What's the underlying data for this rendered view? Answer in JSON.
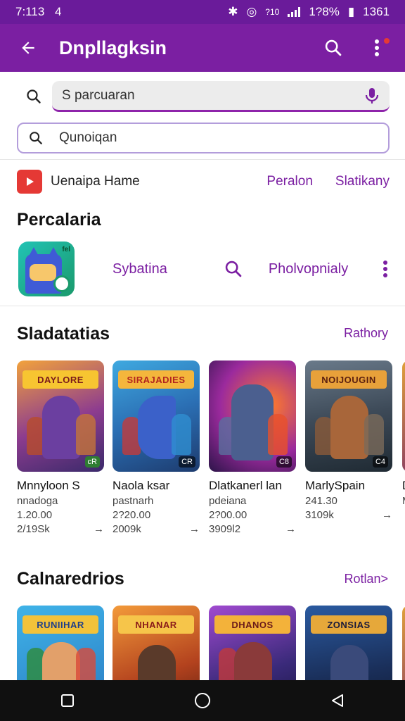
{
  "status": {
    "time": "7:113",
    "extra": "4",
    "battery": "1?8%",
    "clock2": "1361",
    "net": "?10"
  },
  "appbar": {
    "title": "Dnpllagksin"
  },
  "search_primary": {
    "value": "S parcuaran"
  },
  "search_secondary": {
    "value": "Qunoiqan"
  },
  "yt_row": {
    "name": "Uenaipa Hame",
    "link1": "Peralon",
    "link2": "Slatikany"
  },
  "section_perc": {
    "title": "Percalaria"
  },
  "app_row": {
    "link1": "Sybatina",
    "link2": "Pholvopnialy",
    "icon_tag": "fel"
  },
  "section1": {
    "title": "Sladatatias",
    "link": "Rathory",
    "cards": [
      {
        "banner": "DAYLORE",
        "title": "Mnnyloon S",
        "sub": "nnadoga",
        "price": "1.20.00",
        "count": "2/19Sk",
        "badge": "cR"
      },
      {
        "banner": "SIRAJADIES",
        "title": "Naola ksar",
        "sub": "pastnarh",
        "price": "2?20.00",
        "count": "2009k",
        "badge": "CR"
      },
      {
        "banner": "",
        "title": "Dlatkanerl lan",
        "sub": "pdeiana",
        "price": "2?00.00",
        "count": "3909l2",
        "badge": "C8"
      },
      {
        "banner": "NOIJOUGIN",
        "title": "MarlySpain",
        "sub": "",
        "price": "241.30",
        "count": "3109k",
        "badge": "C4"
      },
      {
        "banner": "",
        "title": "D",
        "sub": "M",
        "price": "",
        "count": "",
        "badge": ""
      }
    ]
  },
  "section2": {
    "title": "Calnaredrios",
    "link": "Rotlan>",
    "cards": [
      {
        "banner": "RUNIIHAR"
      },
      {
        "banner": "NHANAR"
      },
      {
        "banner": "DHANOS"
      },
      {
        "banner": "ZONSIAS"
      },
      {
        "banner": ""
      }
    ]
  },
  "colors": {
    "primary": "#7b1fa2",
    "statusbar": "#6a1b9a",
    "accent_text": "#7b1fa2",
    "youtube_red": "#e53935"
  }
}
